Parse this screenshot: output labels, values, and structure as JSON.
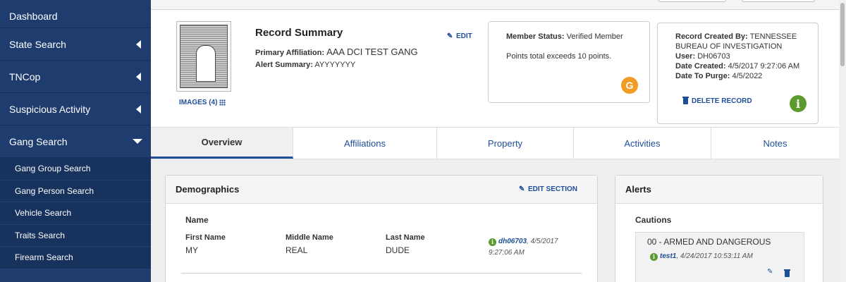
{
  "sidebar": {
    "items": [
      {
        "label": "Dashboard"
      },
      {
        "label": "State Search"
      },
      {
        "label": "TNCop"
      },
      {
        "label": "Suspicious Activity"
      },
      {
        "label": "Gang Search"
      }
    ],
    "sub_items": [
      {
        "label": "Gang Group Search"
      },
      {
        "label": "Gang Person Search"
      },
      {
        "label": "Vehicle Search"
      },
      {
        "label": "Traits Search"
      },
      {
        "label": "Firearm Search"
      }
    ]
  },
  "record": {
    "images_label": "IMAGES (4)",
    "title": "Record Summary",
    "primary_affiliation_label": "Primary Affiliation:",
    "primary_affiliation_value": "AAA DCI TEST GANG",
    "alert_summary_label": "Alert Summary:",
    "alert_summary_value": "AYYYYYYY",
    "edit_label": "EDIT"
  },
  "member": {
    "status_label": "Member Status:",
    "status_value": "Verified Member",
    "points_text": "Points total exceeds 10 points.",
    "badge": "G",
    "badge_color": "#f29b25"
  },
  "created": {
    "created_by_label": "Record Created By:",
    "created_by_value_1": "TENNESSEE",
    "created_by_value_2": "BUREAU OF INVESTIGATION",
    "user_label": "User:",
    "user_value": "DH06703",
    "date_created_label": "Date Created:",
    "date_created_value": "4/5/2017 9:27:06 AM",
    "date_purge_label": "Date To Purge:",
    "date_purge_value": "4/5/2022",
    "delete_label": "DELETE RECORD",
    "info_badge": "i",
    "info_color": "#5b9a2c"
  },
  "tabs": [
    {
      "label": "Overview",
      "active": true
    },
    {
      "label": "Affiliations"
    },
    {
      "label": "Property"
    },
    {
      "label": "Activities"
    },
    {
      "label": "Notes"
    }
  ],
  "demographics": {
    "title": "Demographics",
    "edit_section": "EDIT SECTION",
    "name_heading": "Name",
    "first_name_label": "First Name",
    "first_name_value": "MY",
    "middle_name_label": "Middle Name",
    "middle_name_value": "REAL",
    "last_name_label": "Last Name",
    "last_name_value": "DUDE",
    "audit_user": "dh06703",
    "audit_date": ", 4/5/2017",
    "audit_time": "9:27:06 AM"
  },
  "alerts": {
    "title": "Alerts",
    "cautions_heading": "Cautions",
    "caution_text": "00 - ARMED AND DANGEROUS",
    "audit_user": "test1",
    "audit_time": ", 4/24/2017 10:53:11 AM"
  },
  "colors": {
    "sidebar": "#1f3c6e",
    "link": "#1f4e99"
  }
}
